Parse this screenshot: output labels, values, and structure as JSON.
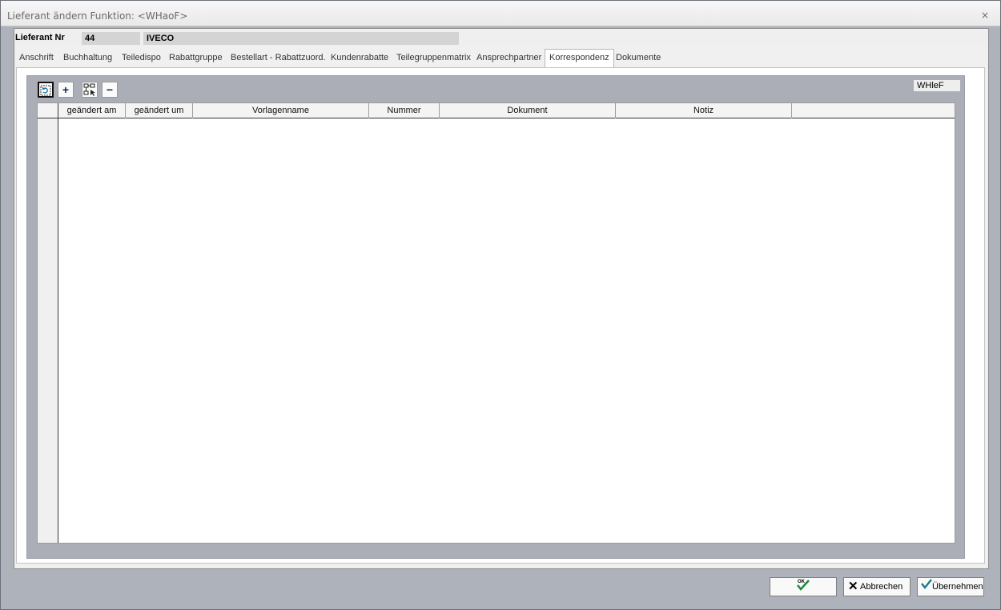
{
  "window": {
    "title": "Lieferant ändern   Funktion: <WHaoF>",
    "close_glyph": "×"
  },
  "header": {
    "label": "Lieferant Nr",
    "number": "44",
    "name": "IVECO"
  },
  "tabs": [
    {
      "label": "Anschrift",
      "active": false
    },
    {
      "label": "Buchhaltung",
      "active": false
    },
    {
      "label": "Teiledispo",
      "active": false
    },
    {
      "label": "Rabattgruppe",
      "active": false
    },
    {
      "label": "Bestellart - Rabattzuord.",
      "active": false
    },
    {
      "label": "Kundenrabatte",
      "active": false
    },
    {
      "label": "Teilegruppenmatrix",
      "active": false
    },
    {
      "label": "Ansprechpartner",
      "active": false
    },
    {
      "label": "Korrespondenz",
      "active": true
    },
    {
      "label": "Dokumente",
      "active": false
    }
  ],
  "toolbar": {
    "refresh_icon": "refresh-icon",
    "add_symbol": "+",
    "tree_icon": "tree-select-icon",
    "remove_symbol": "−",
    "code": "WHleF"
  },
  "grid": {
    "columns": [
      "geändert am",
      "geändert um",
      "Vorlagenname",
      "Nummer",
      "Dokument",
      "Notiz"
    ],
    "rows": []
  },
  "footer": {
    "ok_label": "OK",
    "cancel_label": "Abbrechen",
    "apply_label": "Übernehmen"
  },
  "colors": {
    "accent_check": "#1a8a3a",
    "toolbar_blue": "#10264f"
  }
}
